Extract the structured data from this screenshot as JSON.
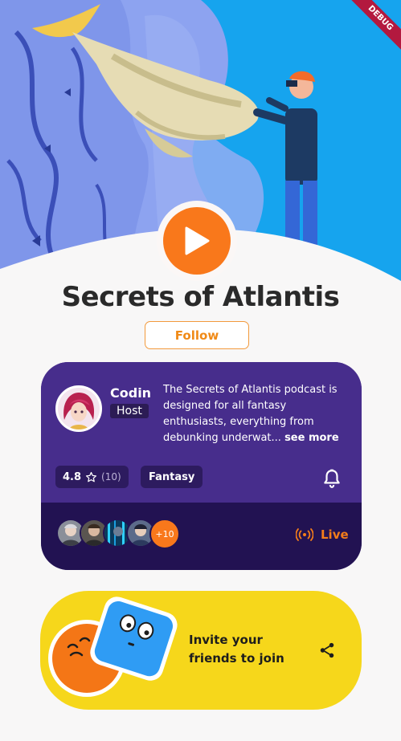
{
  "app": {
    "debug_banner": "DEBUG"
  },
  "podcast": {
    "title": "Secrets of Atlantis",
    "follow_label": "Follow",
    "host_name": "Codin",
    "host_role": "Host",
    "description": "The Secrets of Atlantis podcast is designed for all fantasy enthusiasts, everything from debunking underwat...",
    "see_more": "see more",
    "rating": "4.8",
    "rating_count": "(10)",
    "genre": "Fantasy",
    "listeners_more": "+10",
    "live_label": "Live"
  },
  "invite": {
    "line1": "Invite your",
    "line2": "friends to join"
  },
  "icons": {
    "play": "play-icon",
    "star": "star-outline-icon",
    "bell": "bell-icon",
    "live": "broadcast-icon",
    "share": "share-icon"
  },
  "colors": {
    "accent": "#f9781b",
    "card_top": "#472d8c",
    "card_bottom": "#221252",
    "invite_bg": "#f6d71b",
    "hero_bg": "#1aa3ef"
  }
}
